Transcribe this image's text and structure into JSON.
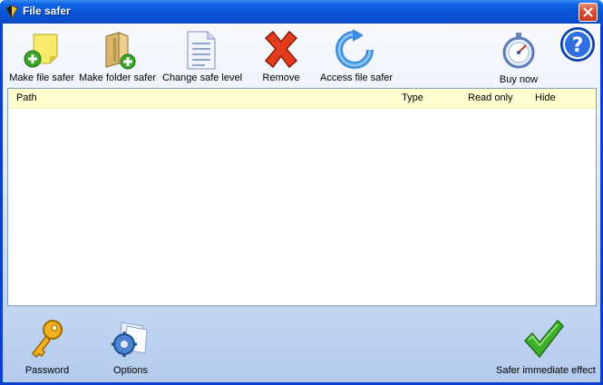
{
  "window": {
    "title": "File safer"
  },
  "toolbar": {
    "make_file_safer": "Make file safer",
    "make_folder_safer": "Make folder safer",
    "change_safe_level": "Change safe level",
    "remove": "Remove",
    "access_file_safer": "Access file safer",
    "buy_now": "Buy now"
  },
  "list": {
    "columns": {
      "path": "Path",
      "type": "Type",
      "read_only": "Read only",
      "hide": "Hide"
    },
    "rows": []
  },
  "bottom": {
    "password": "Password",
    "options": "Options",
    "safer_immediate_effect": "Safer immediate effect"
  },
  "colors": {
    "titlebar": "#0b55d8",
    "header_bg": "#fffecf",
    "list_border": "#7f9db9"
  }
}
